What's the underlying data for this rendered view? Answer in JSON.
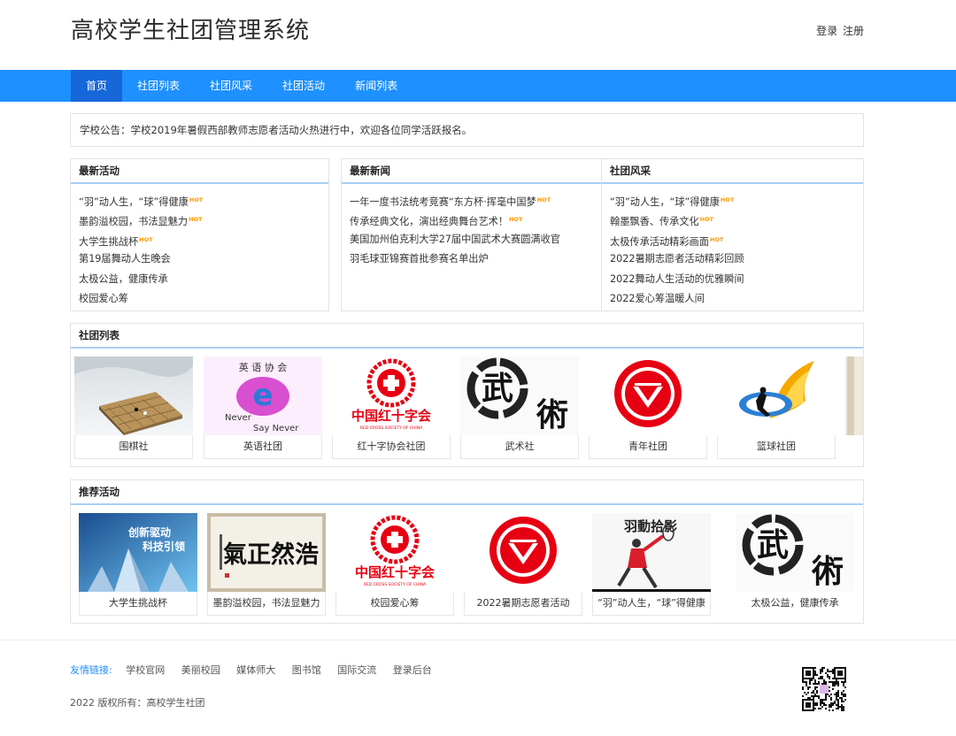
{
  "site": {
    "title": "高校学生社团管理系统"
  },
  "auth": {
    "login": "登录",
    "register": "注册"
  },
  "nav": {
    "items": [
      "首页",
      "社团列表",
      "社团风采",
      "社团活动",
      "新闻列表"
    ]
  },
  "notice": {
    "text": "学校公告：学校2019年暑假西部教师志愿者活动火热进行中，欢迎各位同学活跃报名。"
  },
  "hot_badge": "HOT",
  "activity": {
    "title": "最新活动",
    "items": [
      {
        "text": "“羽”动人生，“球”得健康",
        "hot": true
      },
      {
        "text": "墨韵溢校园，书法显魅力",
        "hot": true
      },
      {
        "text": "大学生挑战杯",
        "hot": true
      },
      {
        "text": "第19届舞动人生晚会",
        "hot": false
      },
      {
        "text": "太极公益，健康传承",
        "hot": false
      },
      {
        "text": "校园爱心筹",
        "hot": false
      }
    ]
  },
  "news": {
    "title": "最新新闻",
    "items": [
      {
        "text": "一年一度书法统考竞赛“东方杯·挥毫中国梦",
        "hot": true
      },
      {
        "text": "传承经典文化，演出经典舞台艺术！",
        "hot": true
      },
      {
        "text": "美国加州伯克利大学27届中国武术大赛圆满收官",
        "hot": false
      },
      {
        "text": "羽毛球亚锦赛首批参赛名单出炉",
        "hot": false
      }
    ]
  },
  "style": {
    "title": "社团风采",
    "items": [
      {
        "text": "“羽”动人生，“球”得健康",
        "hot": true
      },
      {
        "text": "翰墨飘香、传承文化",
        "hot": true
      },
      {
        "text": "太极传承活动精彩画面",
        "hot": true
      },
      {
        "text": "2022暑期志愿者活动精彩回顾",
        "hot": false
      },
      {
        "text": "2022舞动人生活动的优雅瞬间",
        "hot": false
      },
      {
        "text": "2022爱心筹温暖人间",
        "hot": false
      }
    ]
  },
  "clubs": {
    "title": "社团列表",
    "items": [
      {
        "name": "围棋社",
        "icon": "go-board-image"
      },
      {
        "name": "英语社团",
        "icon": "english-club-logo"
      },
      {
        "name": "红十字协会社团",
        "icon": "red-cross-logo"
      },
      {
        "name": "武术社",
        "icon": "wushu-calligraphy-image"
      },
      {
        "name": "青年社团",
        "icon": "youth-league-logo"
      },
      {
        "name": "篮球社团",
        "icon": "basketball-logo"
      }
    ],
    "english_logo": {
      "arc": "英 语 协 会",
      "motto1": "Never",
      "motto2": "Say Never"
    },
    "redcross": {
      "cn": "中国红十字会",
      "en": "RED CROSS SOCIETY OF CHINA"
    },
    "wushu": {
      "ch1": "武",
      "ch2": "術"
    }
  },
  "recommend": {
    "title": "推荐活动",
    "items": [
      {
        "name": "大学生挑战杯",
        "icon": "innovation-poster"
      },
      {
        "name": "墨韵溢校园，书法显魅力",
        "icon": "calligraphy-scroll"
      },
      {
        "name": "校园爱心筹",
        "icon": "red-cross-logo"
      },
      {
        "name": "2022暑期志愿者活动",
        "icon": "youth-league-logo"
      },
      {
        "name": "“羽”动人生，“球”得健康",
        "icon": "badminton-poster"
      },
      {
        "name": "太极公益，健康传承",
        "icon": "wushu-calligraphy-image"
      }
    ],
    "poster": {
      "line1": "创新驱动",
      "line2": "科技引领"
    },
    "scroll": {
      "text": "氣正然浩"
    },
    "badminton": {
      "text": "羽動拾影"
    }
  },
  "footer": {
    "links_label": "友情链接:",
    "links": [
      "学校官网",
      "美丽校园",
      "媒体师大",
      "图书馆",
      "国际交流",
      "登录后台"
    ],
    "copyright": "2022 版权所有：高校学生社团"
  },
  "colors": {
    "nav": "#1e90ff",
    "nav_active": "#1667d9",
    "hot": "#ff9900",
    "red": "#e60012"
  }
}
